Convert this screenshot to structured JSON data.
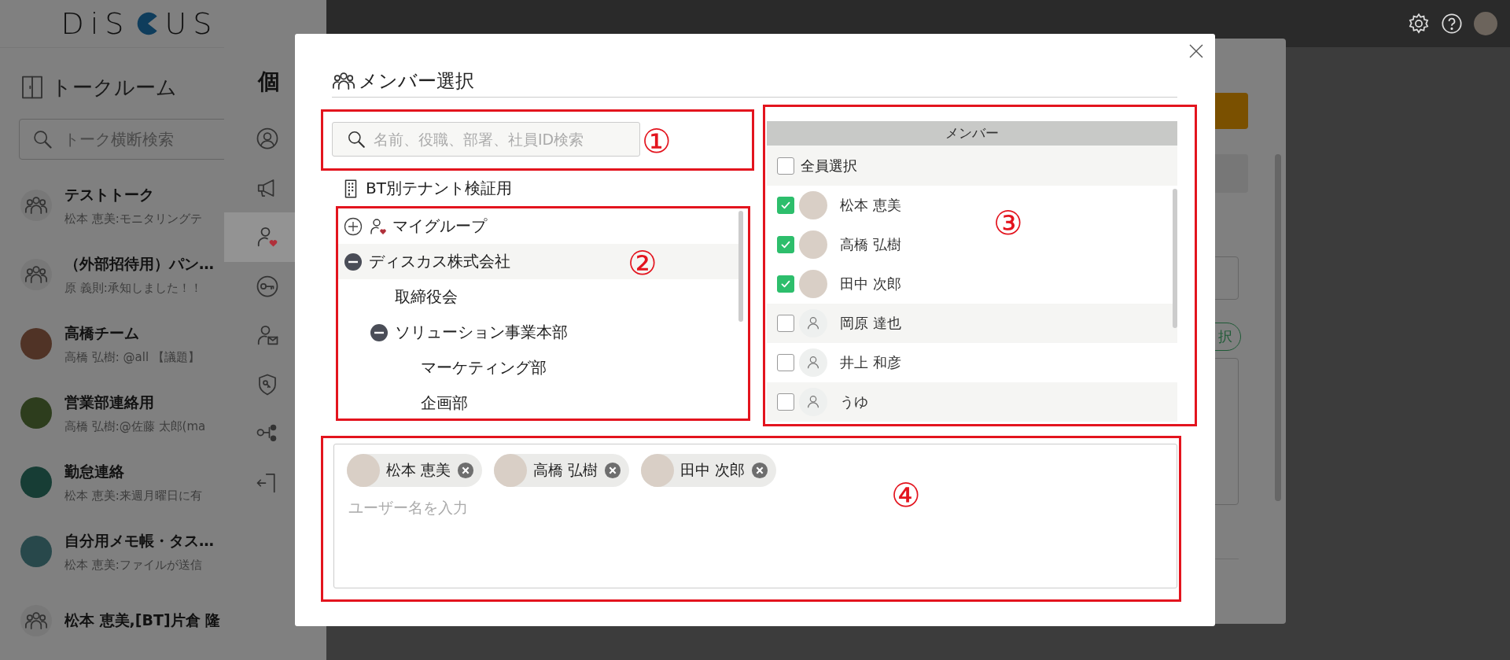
{
  "app": {
    "logo_left": "DiS",
    "logo_right": "US"
  },
  "sidebar": {
    "title": "トークルーム",
    "search": {
      "placeholder": "トーク横断検索"
    },
    "rooms": [
      {
        "title": "テストトーク",
        "preview": "松本 恵美:モニタリングテ",
        "kind": "group"
      },
      {
        "title": "（外部招待用）パン…",
        "preview": "原 義則:承知しました！！",
        "kind": "group"
      },
      {
        "title": "高橋チーム",
        "preview": "高橋 弘樹: @all 【議題】",
        "kind": "image",
        "color": "#503326"
      },
      {
        "title": "営業部連絡用",
        "preview": "高橋 弘樹:@佐藤 太郎(ma",
        "kind": "image",
        "color": "#2d3d1d"
      },
      {
        "title": "勤怠連絡",
        "preview": "松本 恵美:来週月曜日に有",
        "kind": "image",
        "color": "#173d35"
      },
      {
        "title": "自分用メモ帳・タス…",
        "preview": "松本 恵美:ファイルが送信",
        "kind": "image",
        "color": "#28484b"
      },
      {
        "title": "松本 恵美,[BT]片倉 隆",
        "kind": "group"
      }
    ]
  },
  "settings_panel": {
    "title": "個",
    "nav": [
      {
        "selected": false
      },
      {
        "selected": false
      },
      {
        "selected": true
      },
      {
        "selected": false
      },
      {
        "selected": false
      },
      {
        "selected": false
      },
      {
        "selected": false
      },
      {
        "selected": false
      }
    ],
    "pill_text": "択"
  },
  "dialog": {
    "title": "メンバー選択",
    "search": {
      "placeholder": "名前、役職、部署、社員ID検索"
    },
    "tenant": "BT別テナント検証用",
    "tree": [
      {
        "label": "マイグループ",
        "kind": "my-group",
        "expanded": false,
        "selected": false
      },
      {
        "label": "ディスカス株式会社",
        "expanded": true,
        "selected": true,
        "children": [
          {
            "label": "取締役会",
            "selected": false
          },
          {
            "label": "ソリューション事業本部",
            "expanded": true,
            "selected": false,
            "children": [
              {
                "label": "マーケティング部",
                "selected": false
              },
              {
                "label": "企画部",
                "selected": false
              }
            ]
          }
        ]
      }
    ],
    "member_list": {
      "header": "メンバー",
      "select_all": {
        "label": "全員選択",
        "checked": false
      },
      "members": [
        {
          "name": "松本 恵美",
          "checked": true,
          "kind": "photo",
          "shaded": false
        },
        {
          "name": "高橋 弘樹",
          "checked": true,
          "kind": "photo",
          "shaded": false
        },
        {
          "name": "田中 次郎",
          "checked": true,
          "kind": "photo",
          "shaded": false
        },
        {
          "name": "岡原 達也",
          "checked": false,
          "kind": "default",
          "shaded": true
        },
        {
          "name": "井上 和彦",
          "checked": false,
          "kind": "default",
          "shaded": false
        },
        {
          "name": "うゆ",
          "checked": false,
          "kind": "default",
          "shaded": true
        }
      ]
    },
    "recipients": {
      "chips": [
        {
          "name": "松本 恵美"
        },
        {
          "name": "高橋 弘樹"
        },
        {
          "name": "田中 次郎"
        }
      ],
      "placeholder": "ユーザー名を入力"
    },
    "annotations": [
      "①",
      "②",
      "③",
      "④"
    ]
  }
}
